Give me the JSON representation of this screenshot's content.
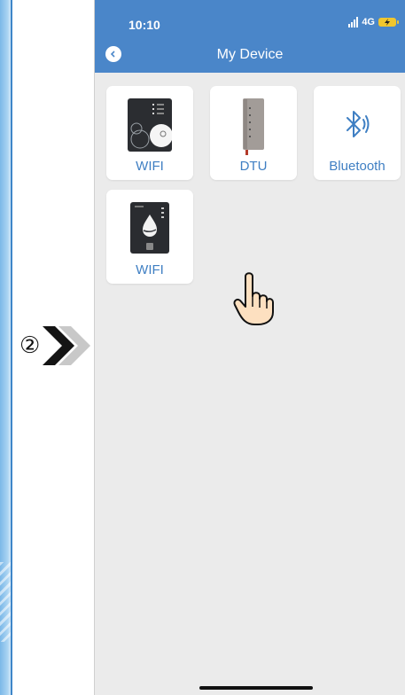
{
  "guide": {
    "step_number": "②"
  },
  "status_bar": {
    "time": "10:10",
    "network": "4G"
  },
  "header": {
    "title": "My Device"
  },
  "devices": [
    {
      "label": "WIFI",
      "icon": "wifi-controller-device-image"
    },
    {
      "label": "DTU",
      "icon": "dtu-device-image"
    },
    {
      "label": "Bluetooth",
      "icon": "bluetooth-icon"
    },
    {
      "label": "WIFI",
      "icon": "water-controller-device-image"
    }
  ],
  "colors": {
    "header": "#4a86c9",
    "accent_text": "#3f7fc3",
    "background": "#ebebeb"
  }
}
